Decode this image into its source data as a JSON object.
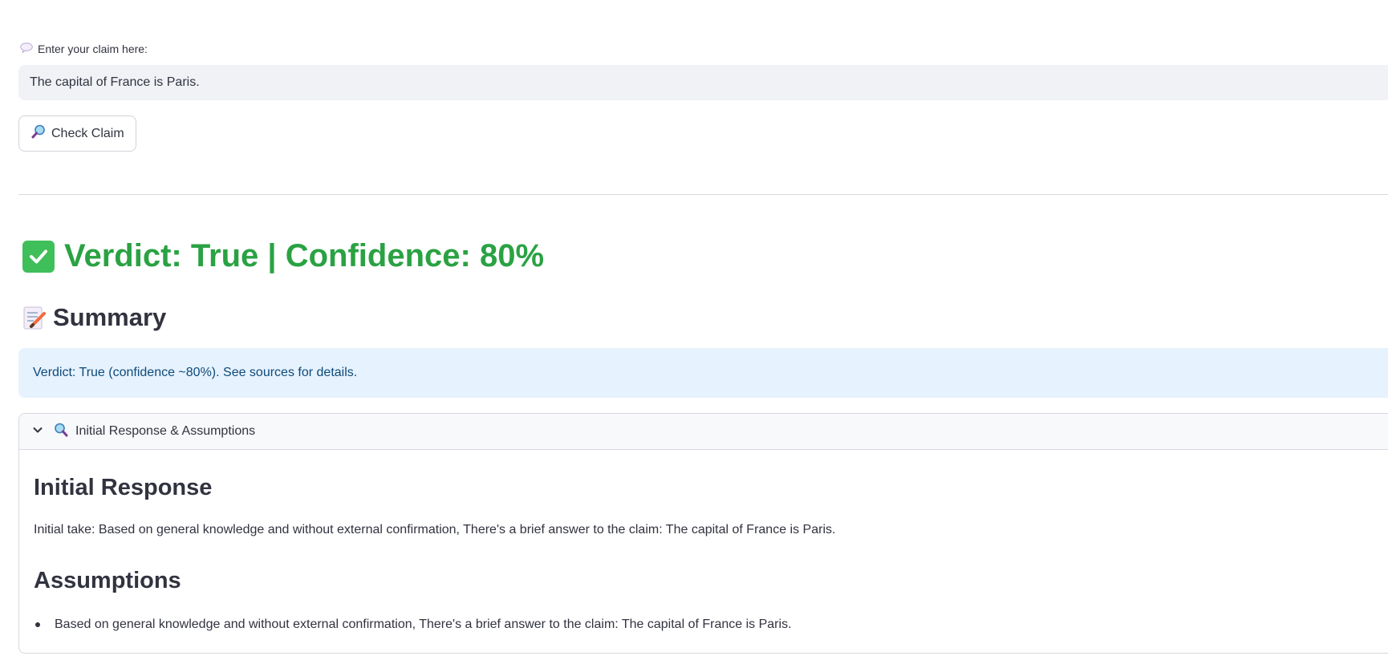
{
  "claim_input": {
    "label": "Enter your claim here:",
    "label_icon": "speech-balloon-icon",
    "value": "The capital of France is Paris."
  },
  "check_button": {
    "label": "Check Claim",
    "icon": "magnifying-glass-right-icon"
  },
  "verdict": {
    "text": "Verdict: True | Confidence: 80%",
    "icon": "check-mark-button-icon",
    "color": "#2aa243"
  },
  "summary": {
    "title": "Summary",
    "icon": "memo-icon",
    "info_text": "Verdict: True (confidence ~80%). See sources for details."
  },
  "expander": {
    "label": "Initial Response & Assumptions",
    "icon": "magnifying-glass-left-icon",
    "expanded": true,
    "initial_response_heading": "Initial Response",
    "initial_response_text": "Initial take: Based on general knowledge and without external confirmation, There's a brief answer to the claim: The capital of France is Paris.",
    "assumptions_heading": "Assumptions",
    "assumptions": [
      "Based on general knowledge and without external confirmation, There's a brief answer to the claim: The capital of France is Paris."
    ]
  },
  "colors": {
    "input_bg": "#f0f2f6",
    "info_bg": "#e6f2fd",
    "info_text": "#0d4a7a",
    "text": "#31333f"
  }
}
